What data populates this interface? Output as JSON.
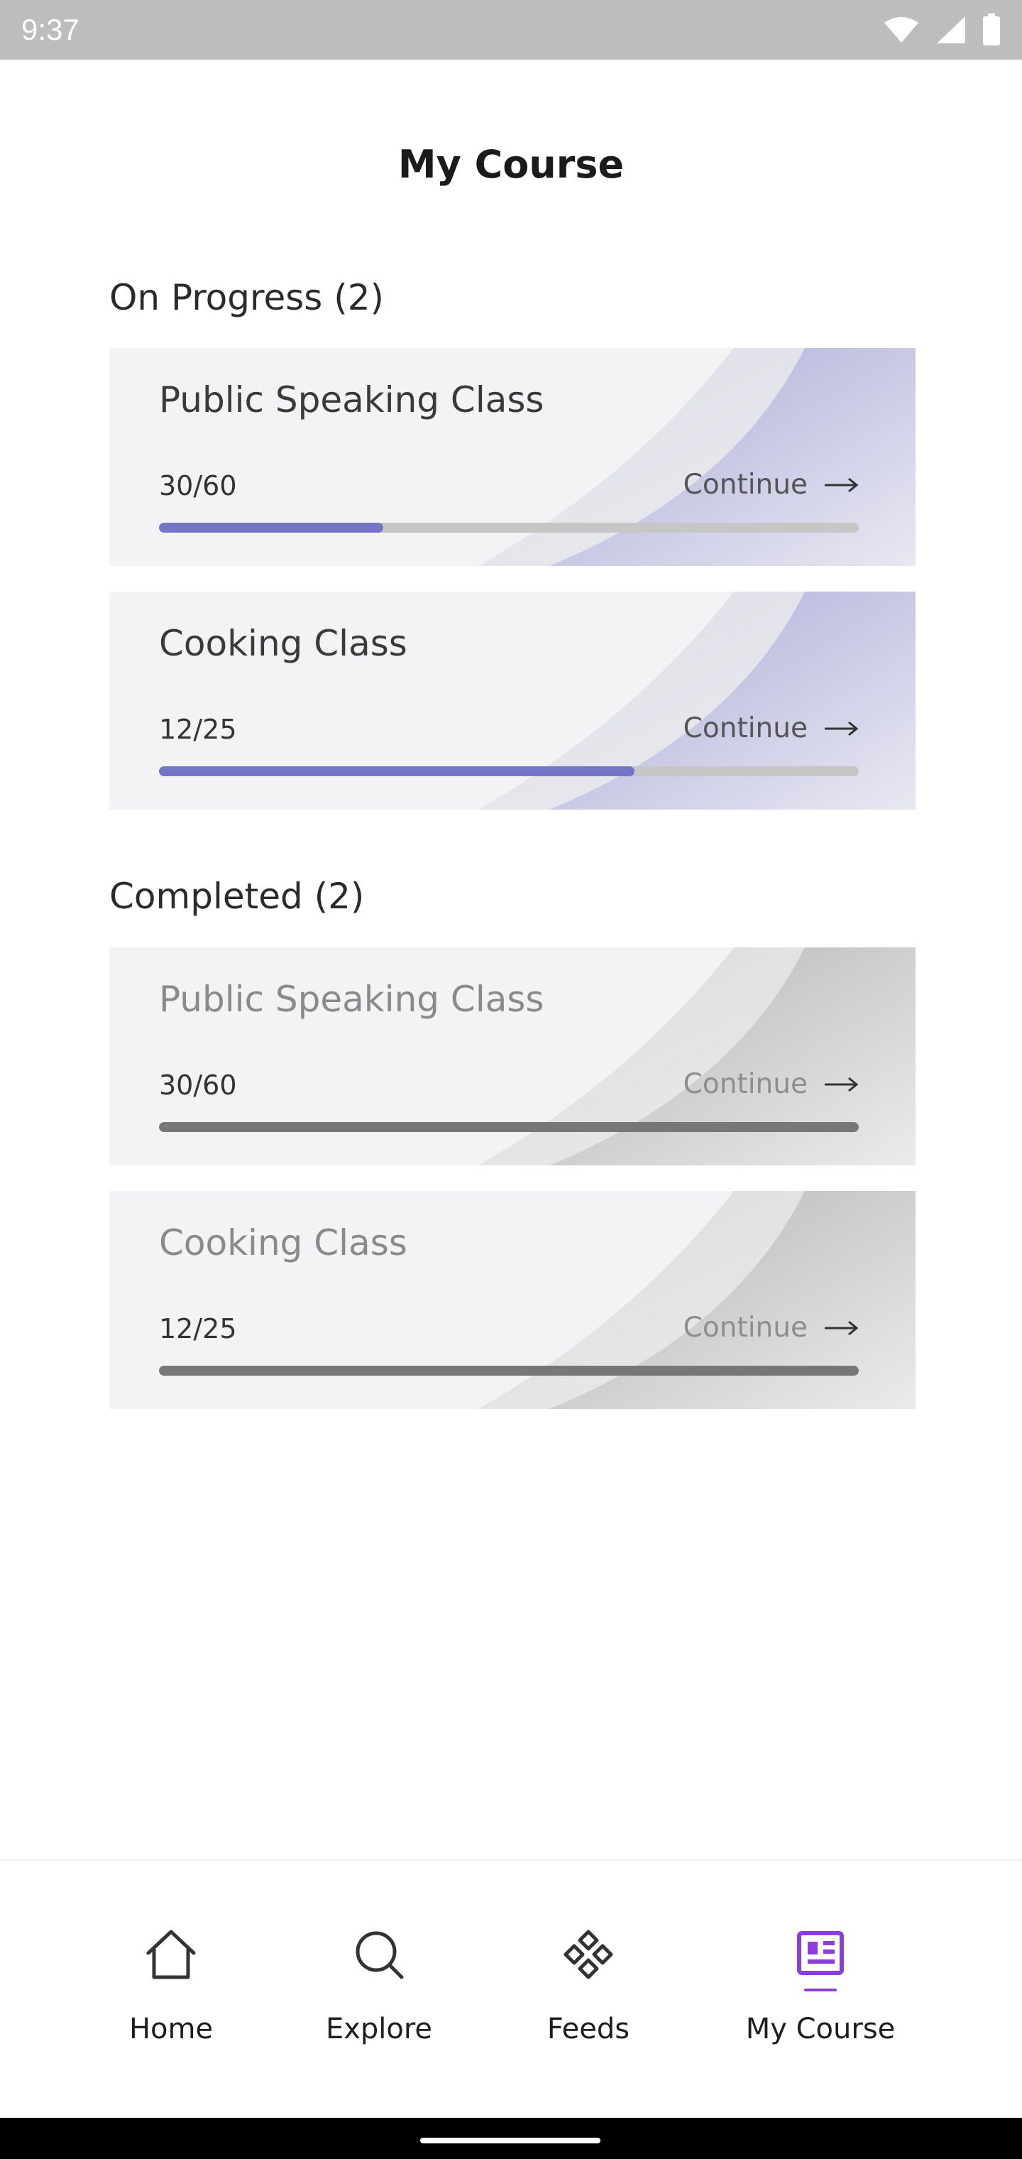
{
  "status_bar": {
    "time": "9:37"
  },
  "page": {
    "title": "My Course"
  },
  "sections": {
    "on_progress": {
      "title": "On Progress (2)"
    },
    "completed": {
      "title": "Completed (2)"
    }
  },
  "cards": {
    "in_progress": [
      {
        "title": "Public Speaking Class",
        "count": "30/60",
        "continue_label": "Continue",
        "progress": 0.32
      },
      {
        "title": "Cooking Class",
        "count": "12/25",
        "continue_label": "Continue",
        "progress": 0.68
      }
    ],
    "completed": [
      {
        "title": "Public Speaking Class",
        "count": "30/60",
        "continue_label": "Continue",
        "progress": 1.0
      },
      {
        "title": "Cooking Class",
        "count": "12/25",
        "continue_label": "Continue",
        "progress": 1.0
      }
    ]
  },
  "bottom_nav": {
    "items": [
      {
        "label": "Home",
        "icon": "home-icon"
      },
      {
        "label": "Explore",
        "icon": "search-icon"
      },
      {
        "label": "Feeds",
        "icon": "feeds-icon"
      },
      {
        "label": "My Course",
        "icon": "course-icon",
        "active": true
      }
    ]
  },
  "colors": {
    "accent": "#8b3fd8",
    "progress_fill": "#7575c7",
    "completed_fill": "#777777",
    "status_bar": "#bdbdbd"
  }
}
